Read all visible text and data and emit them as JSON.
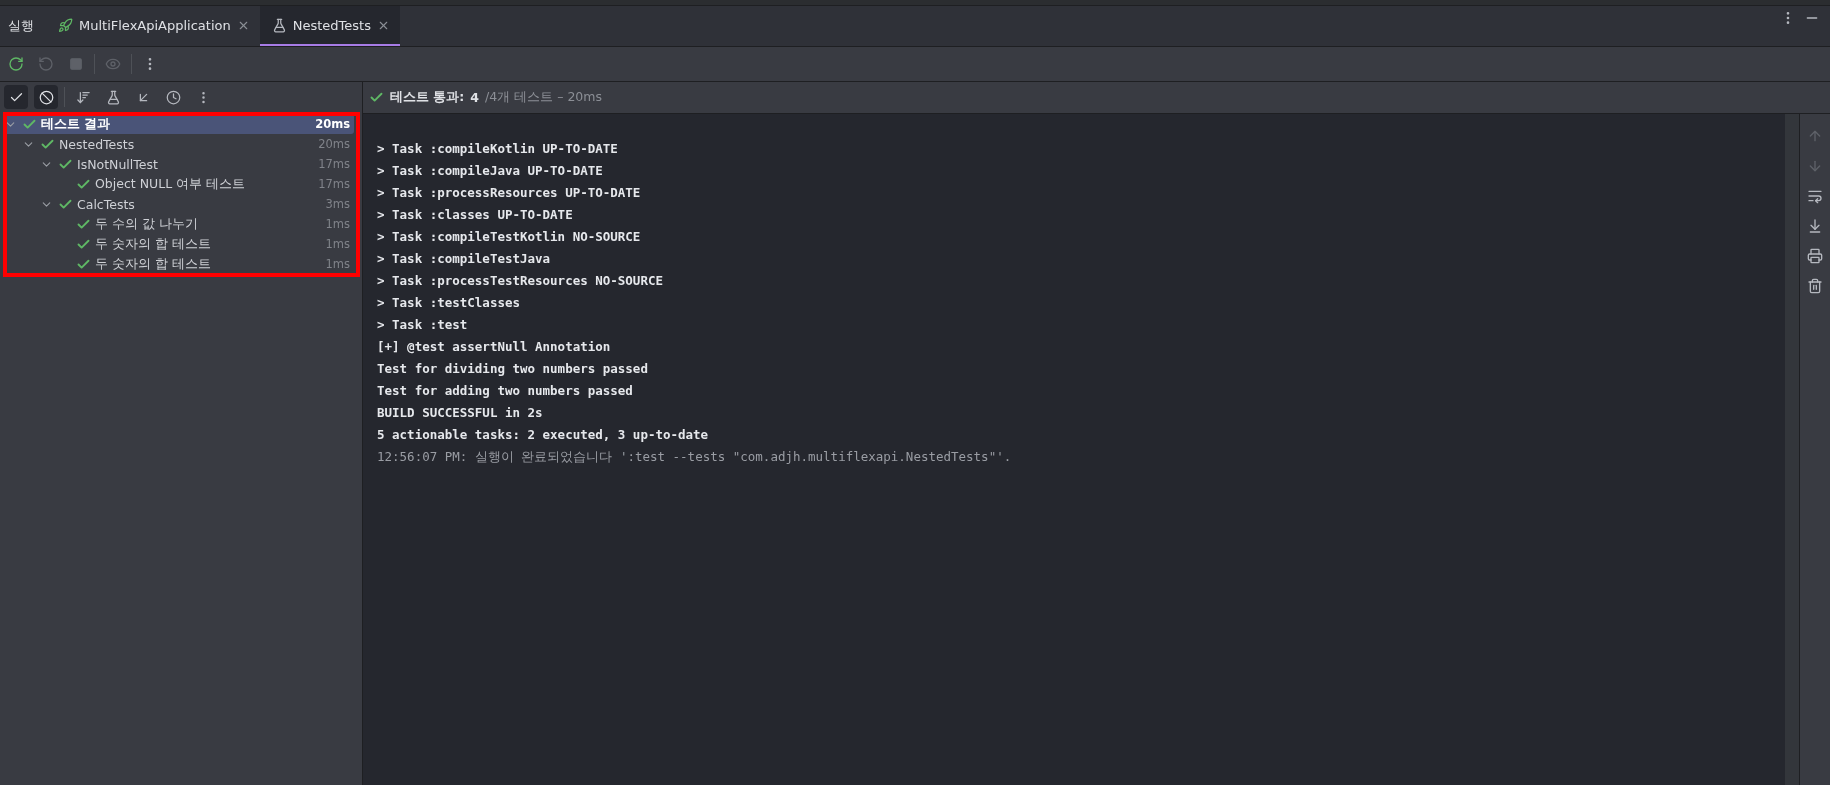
{
  "tool_window": {
    "title": "실행"
  },
  "tabs": [
    {
      "label": "MultiFlexApiApplication",
      "kind": "app",
      "selected": false
    },
    {
      "label": "NestedTests",
      "kind": "test",
      "selected": true
    }
  ],
  "status": {
    "label": "테스트 통과:",
    "count": "4",
    "detail": "/4개 테스트 – 20ms"
  },
  "tree": [
    {
      "label": "테스트 결과",
      "time": "20ms",
      "selected": true,
      "expanded": true,
      "children": [
        {
          "label": "NestedTests",
          "time": "20ms",
          "selected": false,
          "expanded": true,
          "children": [
            {
              "label": "IsNotNullTest",
              "time": "17ms",
              "selected": false,
              "expanded": true,
              "children": [
                {
                  "label": "Object NULL 여부 테스트",
                  "time": "17ms",
                  "selected": false
                }
              ]
            },
            {
              "label": "CalcTests",
              "time": "3ms",
              "selected": false,
              "expanded": true,
              "children": [
                {
                  "label": "두 수의 값 나누기",
                  "time": "1ms",
                  "selected": false
                },
                {
                  "label": "두 숫자의 합 테스트",
                  "time": "1ms",
                  "selected": false
                },
                {
                  "label": "두 숫자의 합 테스트",
                  "time": "1ms",
                  "selected": false
                }
              ]
            }
          ]
        }
      ]
    }
  ],
  "console": {
    "lines": [
      {
        "kind": "output",
        "text": "> Task :compileKotlin UP-TO-DATE"
      },
      {
        "kind": "output",
        "text": "> Task :compileJava UP-TO-DATE"
      },
      {
        "kind": "output",
        "text": "> Task :processResources UP-TO-DATE"
      },
      {
        "kind": "output",
        "text": "> Task :classes UP-TO-DATE"
      },
      {
        "kind": "output",
        "text": "> Task :compileTestKotlin NO-SOURCE"
      },
      {
        "kind": "output",
        "text": "> Task :compileTestJava"
      },
      {
        "kind": "output",
        "text": "> Task :processTestResources NO-SOURCE"
      },
      {
        "kind": "output",
        "text": "> Task :testClasses"
      },
      {
        "kind": "output",
        "text": "> Task :test"
      },
      {
        "kind": "output",
        "text": "[+] @test assertNull Annotation"
      },
      {
        "kind": "output",
        "text": "Test for dividing two numbers passed"
      },
      {
        "kind": "output",
        "text": "Test for adding two numbers passed"
      },
      {
        "kind": "output",
        "text": "BUILD SUCCESSFUL in 2s"
      },
      {
        "kind": "output",
        "text": "5 actionable tasks: 2 executed, 3 up-to-date"
      },
      {
        "kind": "system",
        "text": "12:56:07 PM: 실행이 완료되었습니다 ':test --tests \"com.adjh.multiflexapi.NestedTests\"'."
      }
    ]
  }
}
